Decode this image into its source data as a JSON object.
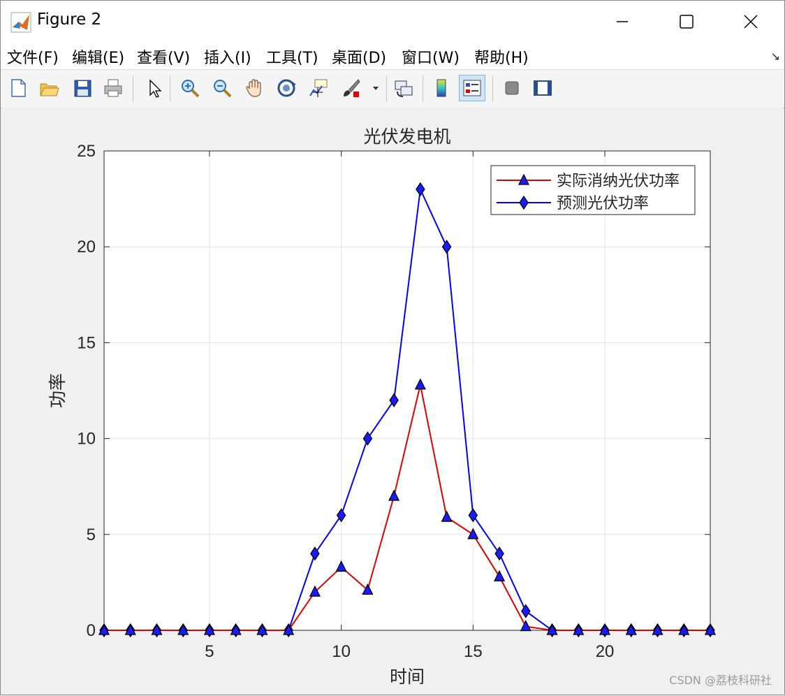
{
  "window": {
    "title": "Figure 2"
  },
  "menu": [
    {
      "label": "文件(F)"
    },
    {
      "label": "编辑(E)"
    },
    {
      "label": "查看(V)"
    },
    {
      "label": "插入(I)"
    },
    {
      "label": "工具(T)"
    },
    {
      "label": "桌面(D)"
    },
    {
      "label": "窗口(W)"
    },
    {
      "label": "帮助(H)"
    }
  ],
  "menu_dock_icon": "dock-arrow-icon",
  "toolbar": [
    "new-figure-icon",
    "open-file-icon",
    "save-icon",
    "print-icon",
    "select-arrow-icon",
    "zoom-in-icon",
    "zoom-out-icon",
    "pan-hand-icon",
    "rotate-3d-icon",
    "data-cursor-icon",
    "brush-icon",
    "dropdown-arrow-icon",
    "link-plot-icon",
    "colorbar-icon",
    "legend-icon",
    "hide-plot-tools-icon",
    "show-plot-tools-icon"
  ],
  "colors": {
    "series_actual": "#e00000",
    "series_forecast": "#0000ff",
    "marker_fill": "#1a1aff"
  },
  "chart_data": {
    "type": "line",
    "title": "光伏发电机",
    "xlabel": "时间",
    "ylabel": "功率",
    "xlim": [
      1,
      24
    ],
    "ylim": [
      0,
      25
    ],
    "xticks": [
      5,
      10,
      15,
      20
    ],
    "yticks": [
      0,
      5,
      10,
      15,
      20,
      25
    ],
    "grid": true,
    "legend_position": "top-right",
    "x": [
      1,
      2,
      3,
      4,
      5,
      6,
      7,
      8,
      9,
      10,
      11,
      12,
      13,
      14,
      15,
      16,
      17,
      18,
      19,
      20,
      21,
      22,
      23,
      24
    ],
    "series": [
      {
        "name": "实际消纳光伏功率",
        "marker": "triangle",
        "color": "#e00000",
        "values": [
          0,
          0,
          0,
          0,
          0,
          0,
          0,
          0,
          2.0,
          3.3,
          2.1,
          7.0,
          12.8,
          5.9,
          5.0,
          2.8,
          0.2,
          0,
          0,
          0,
          0,
          0,
          0,
          0
        ]
      },
      {
        "name": "预测光伏功率",
        "marker": "diamond",
        "color": "#0000ff",
        "values": [
          0,
          0,
          0,
          0,
          0,
          0,
          0,
          0,
          4,
          6,
          10,
          12,
          23,
          20,
          6,
          4,
          1,
          0,
          0,
          0,
          0,
          0,
          0,
          0
        ]
      }
    ]
  },
  "watermark": "CSDN @荔枝科研社"
}
